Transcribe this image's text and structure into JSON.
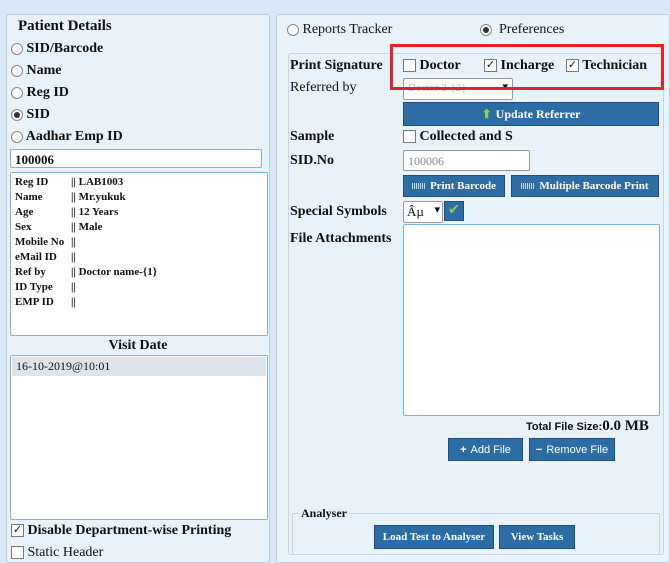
{
  "patient": {
    "title": "Patient Details",
    "options": [
      "SID/Barcode",
      "Name",
      "Reg ID",
      "SID",
      "Aadhar Emp ID"
    ],
    "selected_index": 3,
    "search_value": "100006",
    "info": [
      {
        "key": "Reg ID",
        "sep": "||",
        "val": "LAB1003"
      },
      {
        "key": "Name",
        "sep": "||",
        "val": "Mr.yukuk"
      },
      {
        "key": "Age",
        "sep": "||",
        "val": "12 Years"
      },
      {
        "key": "Sex",
        "sep": "||",
        "val": "Male"
      },
      {
        "key": "Mobile No",
        "sep": "||",
        "val": ""
      },
      {
        "key": "eMail ID",
        "sep": "||",
        "val": ""
      },
      {
        "key": "Ref by",
        "sep": "||",
        "val": "Doctor name-{1}"
      },
      {
        "key": "ID Type",
        "sep": "||",
        "val": ""
      },
      {
        "key": "EMP ID",
        "sep": "||",
        "val": ""
      }
    ],
    "visit_title": "Visit Date",
    "visits": [
      "16-10-2019@10:01"
    ],
    "disable_dept_label": "Disable Department-wise Printing",
    "static_header_label": "Static Header"
  },
  "tabs": {
    "reports_tracker": "Reports Tracker",
    "preferences": "Preferences",
    "selected": "preferences"
  },
  "prefs": {
    "print_signature_label": "Print Signature",
    "doctor_label": "Doctor",
    "incharge_label": "Incharge",
    "technician_label": "Technician",
    "referred_by_label": "Referred by",
    "referred_by_value": "Doctor 2-{2}",
    "update_referrer_btn": "Update Referrer",
    "sample_label": "Sample",
    "collected_label": "Collected and S",
    "sid_no_label": "SID.No",
    "sid_placeholder": "100006",
    "print_barcode_btn": "Print Barcode",
    "multiple_barcode_btn": "Multiple Barcode Print",
    "special_symbols_label": "Special Symbols",
    "symbol_value": "Âµ",
    "file_attachments_label": "File Attachments",
    "total_file_size_label": "Total File Size:",
    "total_file_size_value": "0.0 MB",
    "add_file_btn": "Add File",
    "remove_file_btn": "Remove File",
    "analyser_label": "Analyser",
    "load_test_btn": "Load Test to Analyser",
    "view_tasks_btn": "View Tasks"
  },
  "colors": {
    "highlight": "#e8202a",
    "button": "#2e6da4",
    "panel_bg": "#e8f2fb"
  }
}
